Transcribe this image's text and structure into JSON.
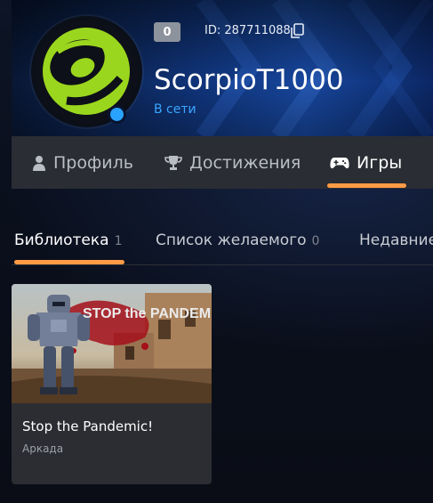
{
  "profile": {
    "level": "0",
    "id_text": "ID: 287711088",
    "username": "ScorpioT1000",
    "status": "В сети"
  },
  "profile_tabs": [
    {
      "label": "Профиль",
      "icon": "person-icon",
      "active": false
    },
    {
      "label": "Достижения",
      "icon": "trophy-icon",
      "active": false
    },
    {
      "label": "Игры",
      "icon": "gamepad-icon",
      "active": true
    }
  ],
  "library_tabs": [
    {
      "label": "Библиотека",
      "count": "1",
      "active": true
    },
    {
      "label": "Список желаемого",
      "count": "0",
      "active": false
    },
    {
      "label": "Недавние",
      "count": "",
      "active": false
    }
  ],
  "games": [
    {
      "title": "Stop the Pandemic!",
      "genre": "Аркада",
      "cover_logo": "STOP the PANDEMIC!"
    }
  ],
  "colors": {
    "accent": "#ff9a45",
    "status_online": "#3aa6ff",
    "avatar_green": "#9bd61e"
  }
}
